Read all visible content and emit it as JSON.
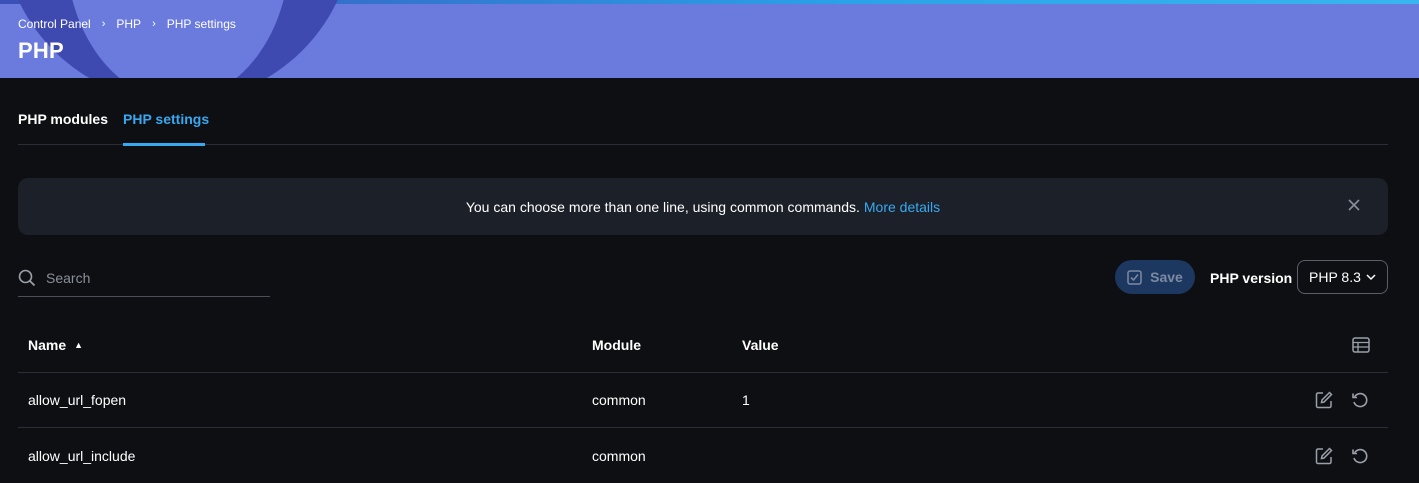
{
  "header": {
    "breadcrumb": [
      "Control Panel",
      "PHP",
      "PHP settings"
    ],
    "title": "PHP"
  },
  "tabs": [
    {
      "label": "PHP modules",
      "active": false
    },
    {
      "label": "PHP settings",
      "active": true
    }
  ],
  "banner": {
    "text": "You can choose more than one line, using common commands.",
    "link": "More details"
  },
  "search": {
    "placeholder": "Search",
    "value": ""
  },
  "toolbar": {
    "save_label": "Save",
    "php_version_label": "PHP version",
    "php_version_selected": "PHP 8.3"
  },
  "table": {
    "columns": [
      "Name",
      "Module",
      "Value"
    ],
    "sorted_column": "Name",
    "sort_direction": "asc",
    "rows": [
      {
        "name": "allow_url_fopen",
        "module": "common",
        "value": "1"
      },
      {
        "name": "allow_url_include",
        "module": "common",
        "value": ""
      }
    ]
  },
  "colors": {
    "header_bg": "#6b7bdd",
    "accent": "#38a8f0",
    "page_bg": "#0e0f13",
    "banner_bg": "#1c2029"
  },
  "icons": {
    "close": "close-icon",
    "search": "search-icon",
    "save": "check-square-icon",
    "dropdown": "chevron-down-icon",
    "columns": "table-columns-icon",
    "edit": "edit-icon",
    "reset": "reset-icon"
  }
}
